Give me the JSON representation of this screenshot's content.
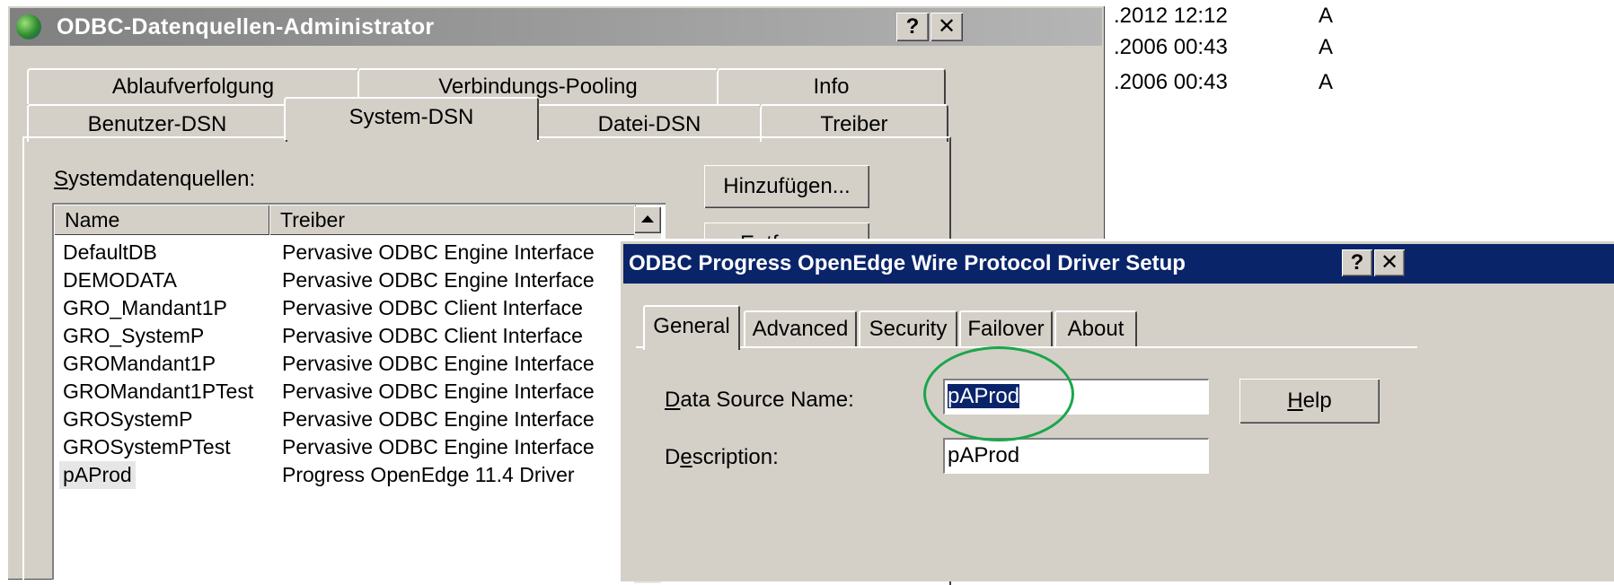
{
  "background_list": [
    {
      "date": ".2012 12:12",
      "attr": "A"
    },
    {
      "date": ".2006 00:43",
      "attr": "A"
    },
    {
      "date": ".2006 00:43",
      "attr": "A"
    }
  ],
  "admin_dialog": {
    "title": "ODBC-Datenquellen-Administrator",
    "help_button": "?",
    "close_button": "✕",
    "tabs_row1": [
      "Ablaufverfolgung",
      "Verbindungs-Pooling",
      "Info"
    ],
    "tabs_row2": [
      "Benutzer-DSN",
      "System-DSN",
      "Datei-DSN",
      "Treiber"
    ],
    "active_tab": "System-DSN",
    "list_label": "Systemdatenquellen:",
    "add_button": "Hinzufügen...",
    "remove_button": "Entfernen",
    "columns": [
      "Name",
      "Treiber"
    ],
    "rows": [
      {
        "name": "DefaultDB",
        "driver": "Pervasive ODBC Engine Interface"
      },
      {
        "name": "DEMODATA",
        "driver": "Pervasive ODBC Engine Interface"
      },
      {
        "name": "GRO_Mandant1P",
        "driver": "Pervasive ODBC Client Interface"
      },
      {
        "name": "GRO_SystemP",
        "driver": "Pervasive ODBC Client Interface"
      },
      {
        "name": "GROMandant1P",
        "driver": "Pervasive ODBC Engine Interface"
      },
      {
        "name": "GROMandant1PTest",
        "driver": "Pervasive ODBC Engine Interface"
      },
      {
        "name": "GROSystemP",
        "driver": "Pervasive ODBC Engine Interface"
      },
      {
        "name": "GROSystemPTest",
        "driver": "Pervasive ODBC Engine Interface"
      },
      {
        "name": "pAProd",
        "driver": "Progress OpenEdge 11.4 Driver"
      }
    ],
    "selected_row": "pAProd"
  },
  "setup_dialog": {
    "title": "ODBC Progress OpenEdge Wire Protocol Driver Setup",
    "help_button": "?",
    "close_button": "✕",
    "tabs": [
      "General",
      "Advanced",
      "Security",
      "Failover",
      "About"
    ],
    "active_tab": "General",
    "dsn_label": "Data Source Name:",
    "dsn_value": "pAProd",
    "description_label": "Description:",
    "description_value": "pAProd",
    "help_label": "Help"
  },
  "colors": {
    "dialog_face": "#d4d0c8",
    "inactive_titlebar": "#808080",
    "active_titlebar": "#0a246a",
    "highlight_circle": "#1aa64a"
  }
}
